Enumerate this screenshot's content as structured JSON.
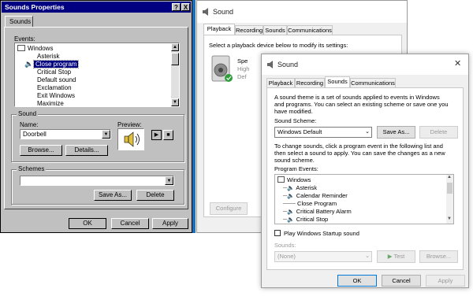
{
  "win95": {
    "title": "Sounds Properties",
    "help_btn": "?",
    "close_btn": "X",
    "tab": "Sounds",
    "events_label": "Events:",
    "events": [
      "Windows",
      "Asterisk",
      "Close program",
      "Critical Stop",
      "Default sound",
      "Exclamation",
      "Exit Windows",
      "Maximize"
    ],
    "selected_event": "Close program",
    "sound_group": "Sound",
    "name_label": "Name:",
    "name_value": "Doorbell",
    "preview_label": "Preview:",
    "browse": "Browse...",
    "details": "Details...",
    "schemes_group": "Schemes",
    "scheme_value": "",
    "save_as": "Save As...",
    "delete": "Delete",
    "ok": "OK",
    "cancel": "Cancel",
    "apply": "Apply"
  },
  "back": {
    "title": "Sound",
    "tabs": [
      "Playback",
      "Recording",
      "Sounds",
      "Communications"
    ],
    "instruction": "Select a playback device below to modify its settings:",
    "device_lines": [
      "Spe",
      "High",
      "Def"
    ],
    "configure": "Configure"
  },
  "front": {
    "title": "Sound",
    "tabs": [
      "Playback",
      "Recording",
      "Sounds",
      "Communications"
    ],
    "intro": [
      "A sound theme is a set of sounds applied to events in Windows",
      "and programs.  You can select an existing scheme or save one you",
      "have modified."
    ],
    "scheme_label": "Sound Scheme:",
    "scheme_value": "Windows Default",
    "save_as": "Save As...",
    "delete": "Delete",
    "change_text": [
      "To change sounds, click a program event in the following list and",
      "then select a sound to apply.  You can save the changes as a new",
      "sound scheme."
    ],
    "events_label": "Program Events:",
    "events": [
      "Windows",
      "Asterisk",
      "Calendar Reminder",
      "Close Program",
      "Critical Battery Alarm",
      "Critical Stop"
    ],
    "startup_label": "Play Windows Startup sound",
    "sounds_label": "Sounds:",
    "sounds_value": "(None)",
    "test": "Test",
    "browse": "Browse...",
    "ok": "OK",
    "cancel": "Cancel",
    "apply": "Apply"
  }
}
